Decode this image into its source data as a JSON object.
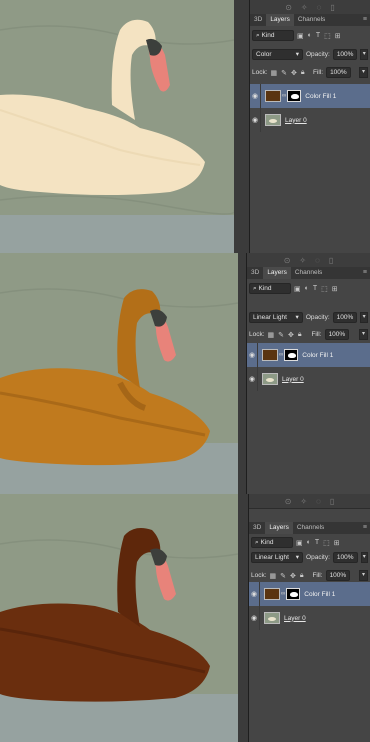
{
  "colors": {
    "water": "#8f9a86",
    "swan_original": "#f4e3c2",
    "swan_linear_light": "#c07a1e",
    "swan_dark": "#6a2e0e",
    "fill_color": "#5a3410",
    "panel_bg": "#454545",
    "selected_row": "#5b6d8c"
  },
  "icons": {
    "topbar": [
      "link-icon",
      "fx-icon",
      "circle-mask-icon",
      "folder-icon",
      "trash-icon"
    ],
    "filter": [
      "pixel-filter-icon",
      "adjustment-filter-icon",
      "type-filter-icon",
      "shape-filter-icon",
      "smart-object-filter-icon"
    ],
    "lock": [
      "lock-transparent-icon",
      "lock-paint-icon",
      "lock-move-icon",
      "lock-all-icon"
    ]
  },
  "panels": [
    {
      "tabs": [
        "3D",
        "Layers",
        "Channels"
      ],
      "active_tab": "Layers",
      "kind_label": "Kind",
      "blend_mode": "Color",
      "opacity_label": "Opacity:",
      "opacity_value": "100%",
      "lock_label": "Lock:",
      "fill_label": "Fill:",
      "fill_value": "100%",
      "layers": [
        {
          "name": "Color Fill 1",
          "selected": true
        },
        {
          "name": "Layer 0",
          "selected": false
        }
      ]
    },
    {
      "tabs": [
        "3D",
        "Layers",
        "Channels"
      ],
      "active_tab": "Layers",
      "kind_label": "Kind",
      "blend_mode": "Linear Light",
      "opacity_label": "Opacity:",
      "opacity_value": "100%",
      "lock_label": "Lock:",
      "fill_label": "Fill:",
      "fill_value": "100%",
      "layers": [
        {
          "name": "Color Fill 1",
          "selected": true
        },
        {
          "name": "Layer 0",
          "selected": false
        }
      ]
    },
    {
      "tabs": [
        "3D",
        "Layers",
        "Channels"
      ],
      "active_tab": "Layers",
      "kind_label": "Kind",
      "blend_mode": "Linear Light",
      "opacity_label": "Opacity:",
      "opacity_value": "100%",
      "lock_label": "Lock:",
      "fill_label": "Fill:",
      "fill_value": "100%",
      "layers": [
        {
          "name": "Color Fill 1",
          "selected": true
        },
        {
          "name": "Layer 0",
          "selected": false
        }
      ]
    }
  ]
}
